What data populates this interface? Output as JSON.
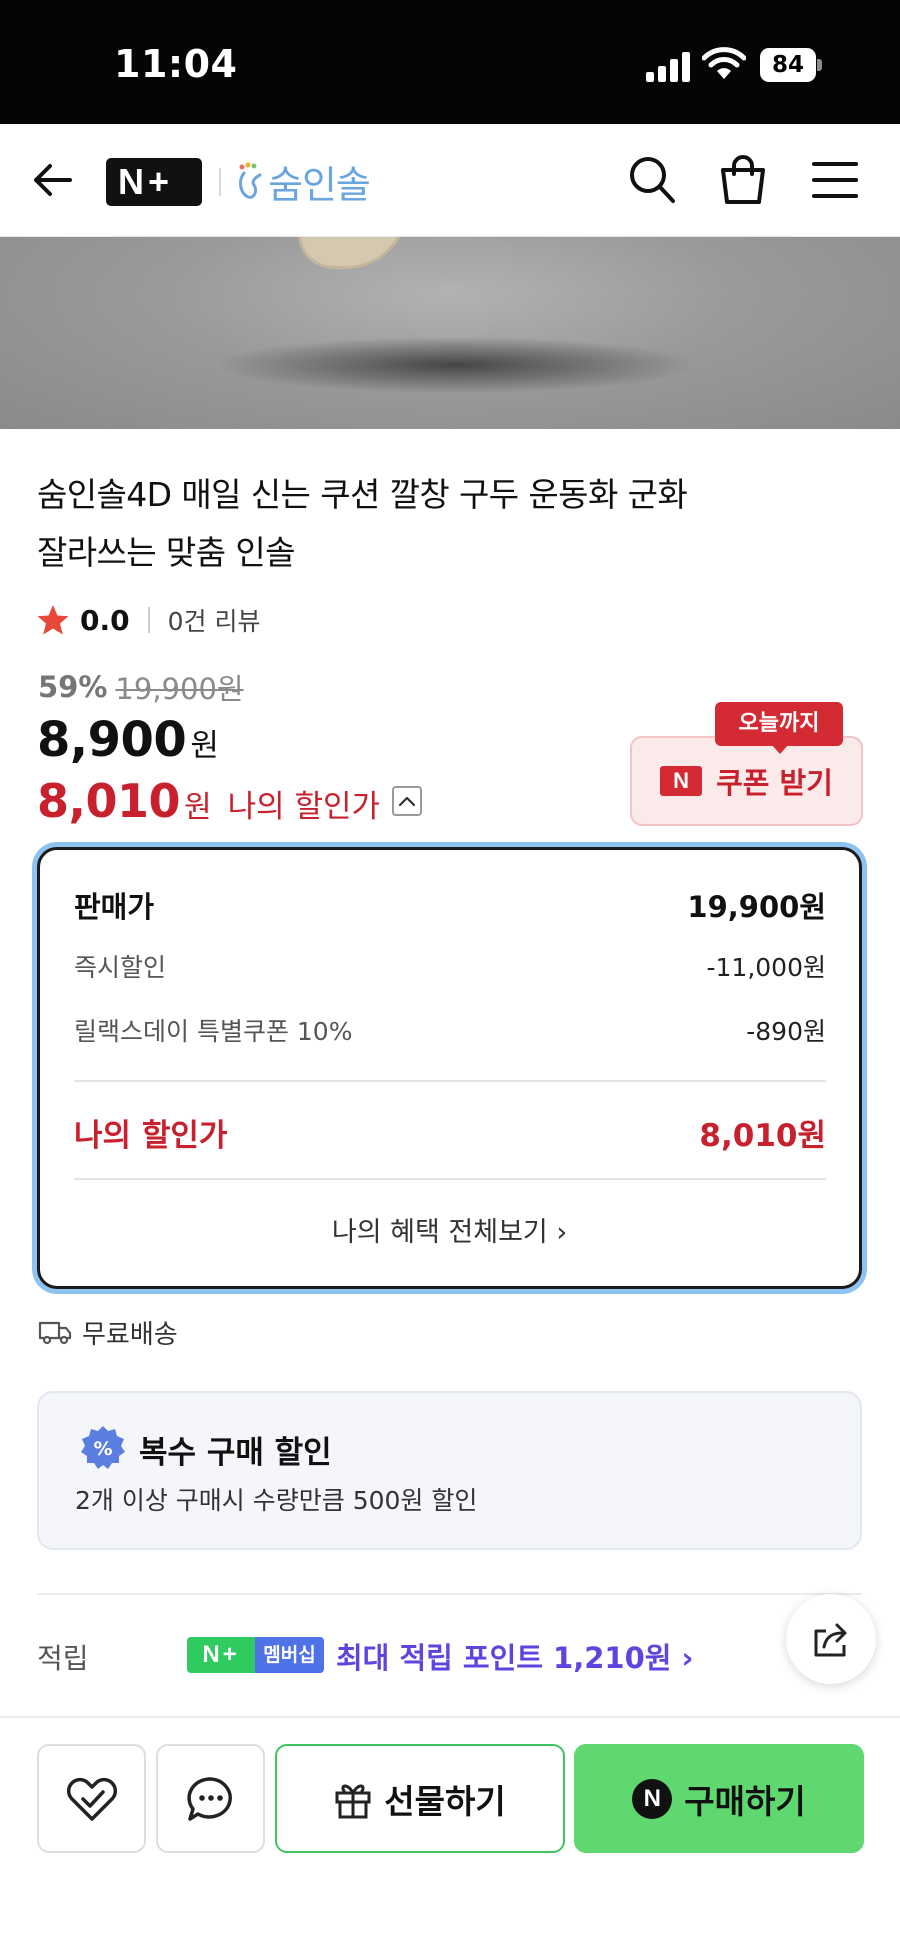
{
  "status_bar": {
    "time": "11:04",
    "battery": "84"
  },
  "header": {
    "brand_name": "숨인솔"
  },
  "product": {
    "title_line1": "숨인솔4D 매일 신는 쿠션 깔창 구두 운동화 군화",
    "title_line2": "잘라쓰는 맞춤 인솔",
    "rating": "0.0",
    "review_count": "0건 리뷰",
    "discount_rate": "59%",
    "original_price": "19,900원",
    "sale_price": "8,900",
    "sale_price_unit": "원",
    "my_price": "8,010",
    "my_price_unit": "원",
    "my_price_label": "나의 할인가"
  },
  "coupon": {
    "badge": "오늘까지",
    "label": "쿠폰 받기",
    "n_mark": "N"
  },
  "price_detail": {
    "rows": [
      {
        "label": "판매가",
        "value": "19,900원"
      },
      {
        "label": "즉시할인",
        "value": "-11,000원"
      },
      {
        "label": "릴랙스데이 특별쿠폰 10%",
        "value": "-890원"
      }
    ],
    "total_label": "나의 할인가",
    "total_value": "8,010원",
    "view_all": "나의 혜택 전체보기 ›"
  },
  "shipping": {
    "label": "무료배송"
  },
  "bulk_discount": {
    "title": "복수 구매 할인",
    "description": "2개 이상 구매시 수량만큼 500원 할인"
  },
  "points": {
    "label": "적립",
    "badge_nplus": "N+",
    "badge_text": "멤버십",
    "text": "최대 적립 포인트 1,210원 ›"
  },
  "bottom_bar": {
    "gift_label": "선물하기",
    "buy_label": "구매하기",
    "buy_n_mark": "N"
  },
  "colors": {
    "accent_red": "#c8202d",
    "buy_green": "#5fd870",
    "points_purple": "#5d45e0",
    "panel_highlight": "#8ec2f0"
  }
}
